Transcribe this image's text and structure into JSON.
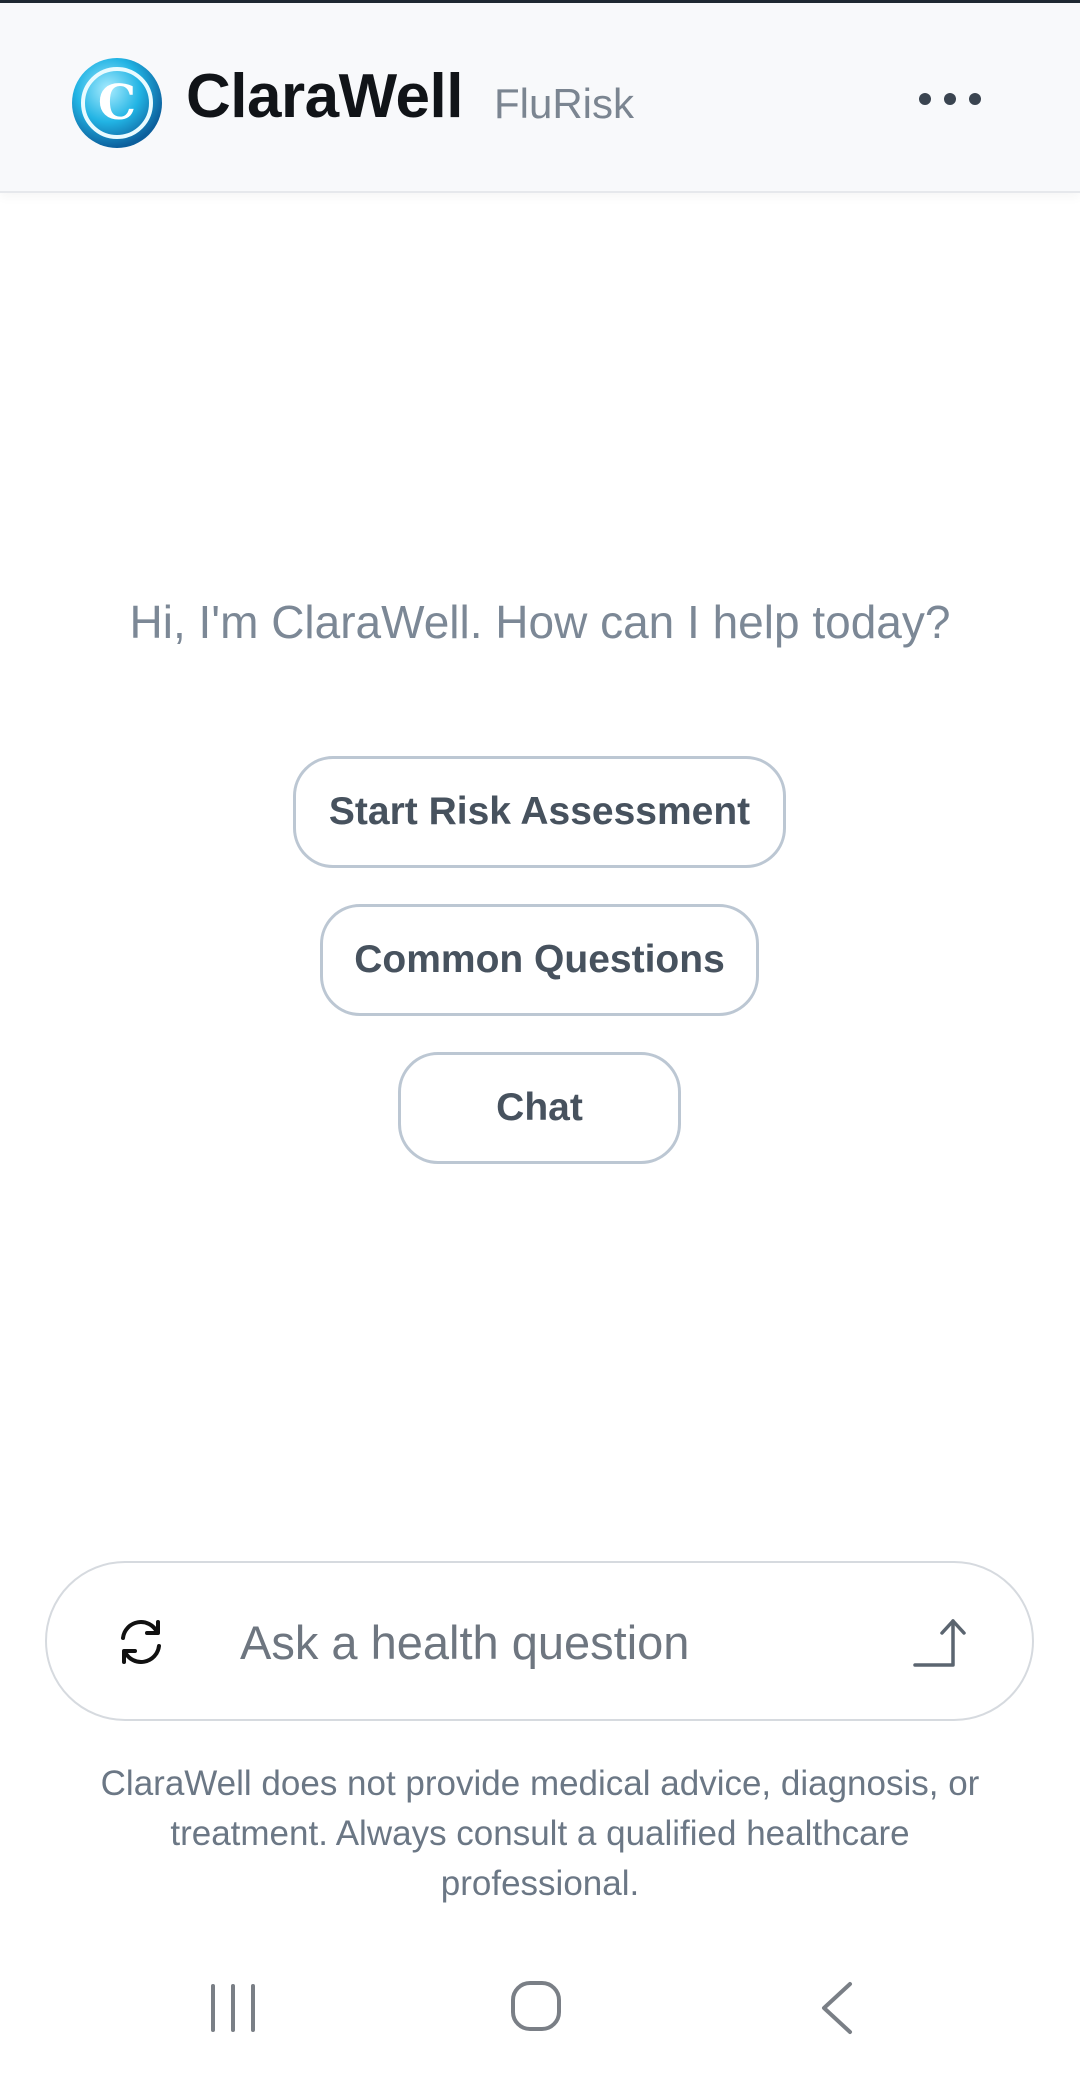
{
  "header": {
    "app_name": "ClaraWell",
    "subtitle": "FluRisk",
    "logo_letter": "C",
    "more_icon": "more-horizontal-icon"
  },
  "main": {
    "greeting": "Hi, I'm ClaraWell. How can I help today?",
    "actions": [
      {
        "label": "Start Risk Assessment"
      },
      {
        "label": "Common Questions"
      },
      {
        "label": "Chat"
      }
    ]
  },
  "composer": {
    "placeholder": "Ask a health question",
    "value": "",
    "left_icon": "refresh-icon",
    "right_icon": "send-arrow-icon"
  },
  "footer": {
    "disclaimer": "ClaraWell does not provide medical advice, diagnosis, or treatment. Always consult a qualified healthcare professional."
  },
  "system_nav": {
    "recent_icon": "recent-apps-icon",
    "home_icon": "home-icon",
    "back_icon": "back-icon"
  },
  "colors": {
    "logo_accent": "#1ba6d6",
    "button_border": "#bcc7d3",
    "button_text": "#47525e",
    "muted_text": "#7c8896"
  }
}
